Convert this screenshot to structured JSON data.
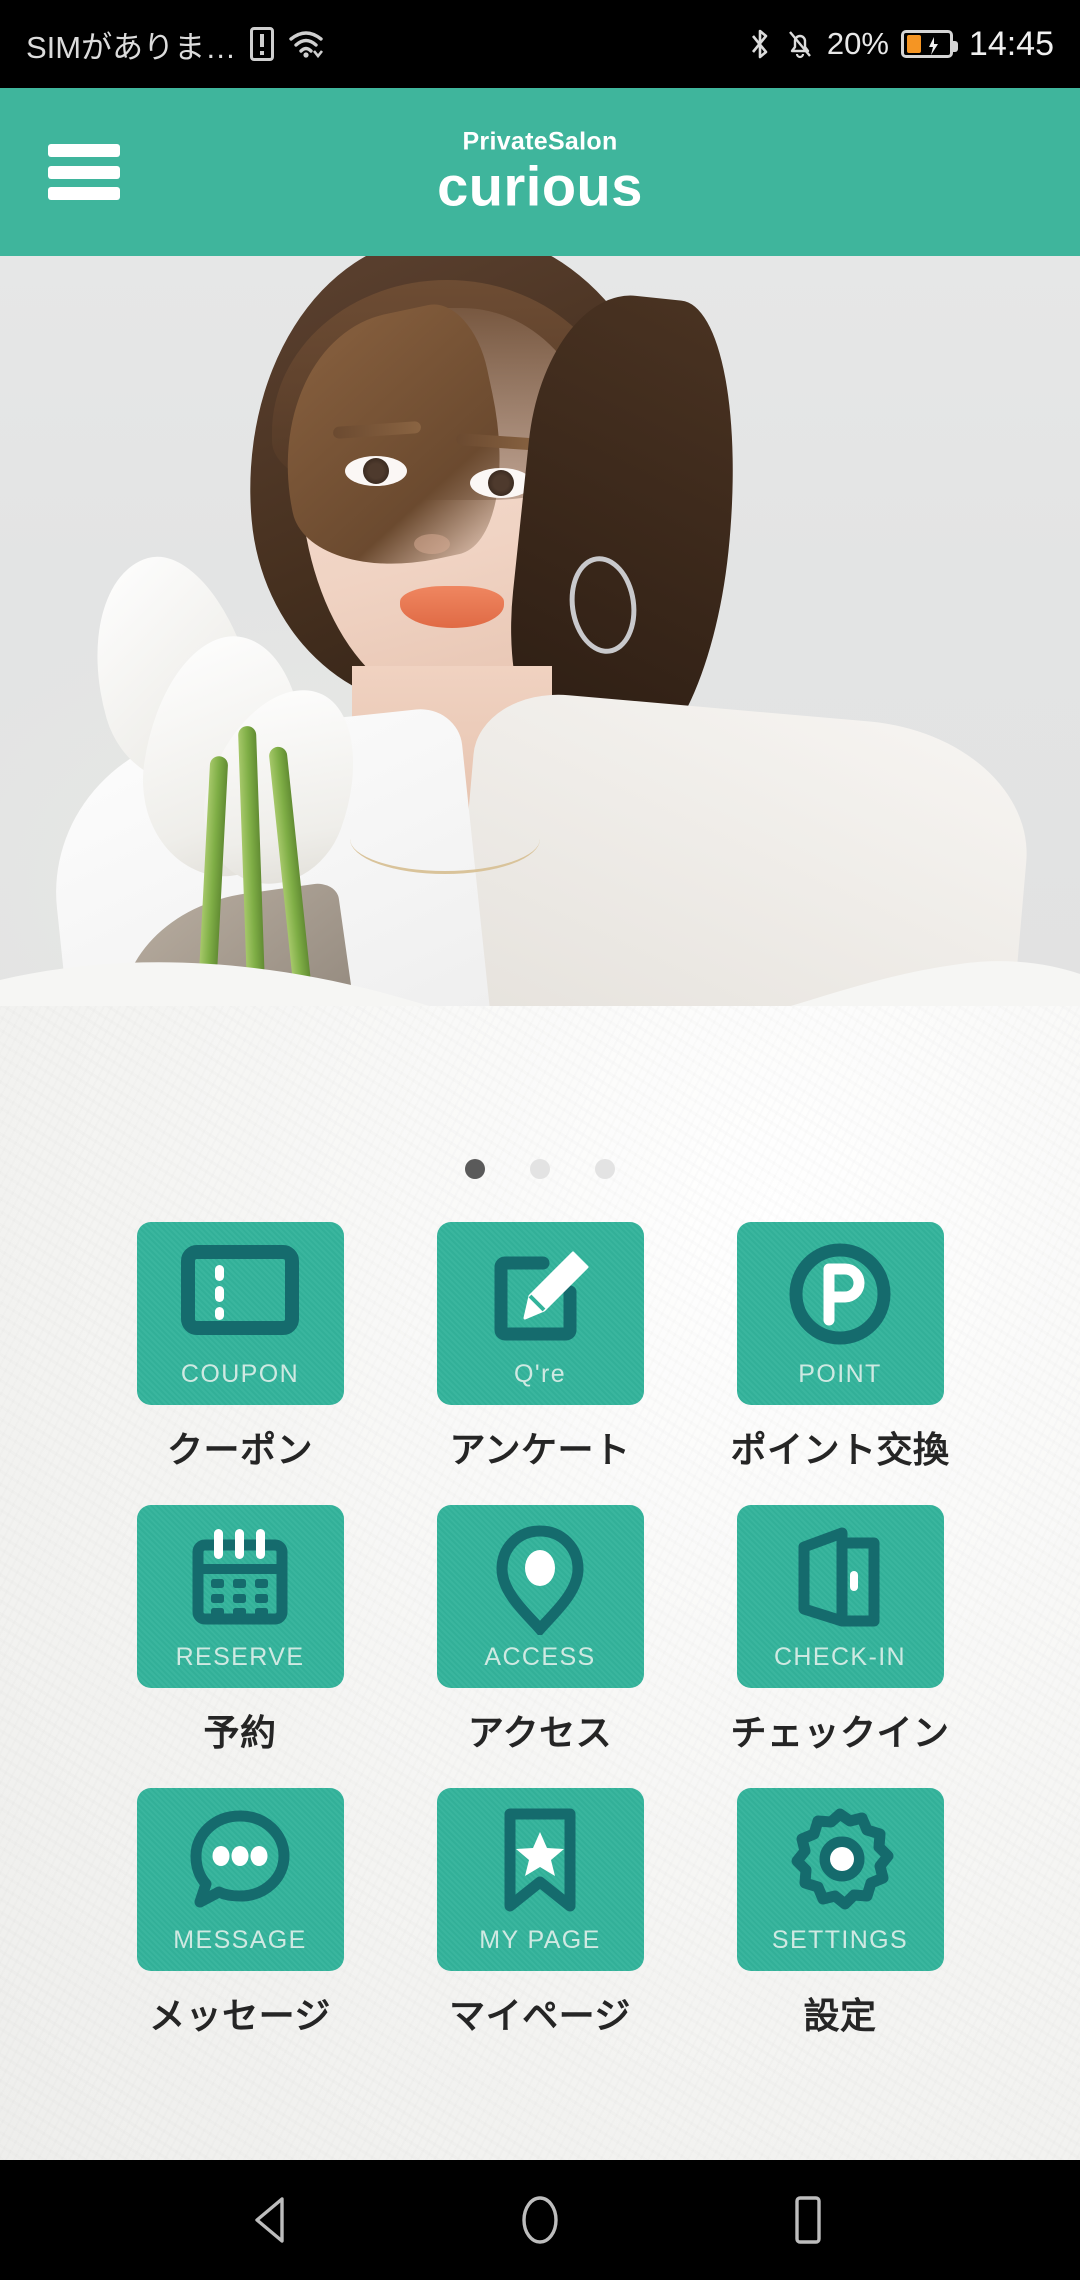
{
  "statusbar": {
    "carrier_text": "SIMがありま…",
    "sim_icon": "sim-card-alert-icon",
    "wifi_icon": "wifi-icon",
    "bluetooth_icon": "bluetooth-icon",
    "mute_icon": "bell-mute-icon",
    "battery_percent": "20%",
    "battery_icon": "battery-charging-icon",
    "time": "14:45"
  },
  "appbar": {
    "menu_icon": "hamburger-menu-icon",
    "brand_sup": "PrivateSalon",
    "brand_main": "curious",
    "background_color": "#3fb59c"
  },
  "hero": {
    "alt": "salon model portrait with calla lilies"
  },
  "carousel": {
    "total": 3,
    "active_index": 0,
    "active_color": "#5a5a5a",
    "inactive_color": "#e3e3e3"
  },
  "grid": {
    "tile_color": "#33b39b",
    "icon_color": "#166b6e",
    "items": [
      {
        "icon": "coupon-ticket-icon",
        "en": "COUPON",
        "jp": "クーポン"
      },
      {
        "icon": "pencil-square-icon",
        "en": "Q're",
        "jp": "アンケート"
      },
      {
        "icon": "point-p-circle-icon",
        "en": "POINT",
        "jp": "ポイント交換"
      },
      {
        "icon": "calendar-icon",
        "en": "RESERVE",
        "jp": "予約"
      },
      {
        "icon": "map-pin-icon",
        "en": "ACCESS",
        "jp": "アクセス"
      },
      {
        "icon": "open-door-icon",
        "en": "CHECK-IN",
        "jp": "チェックイン"
      },
      {
        "icon": "chat-bubble-icon",
        "en": "MESSAGE",
        "jp": "メッセージ"
      },
      {
        "icon": "bookmark-star-icon",
        "en": "MY PAGE",
        "jp": "マイページ"
      },
      {
        "icon": "gear-icon",
        "en": "SETTINGS",
        "jp": "設定"
      }
    ]
  },
  "navbar": {
    "back_icon": "back-triangle-icon",
    "home_icon": "home-circle-icon",
    "recents_icon": "recents-square-icon"
  }
}
